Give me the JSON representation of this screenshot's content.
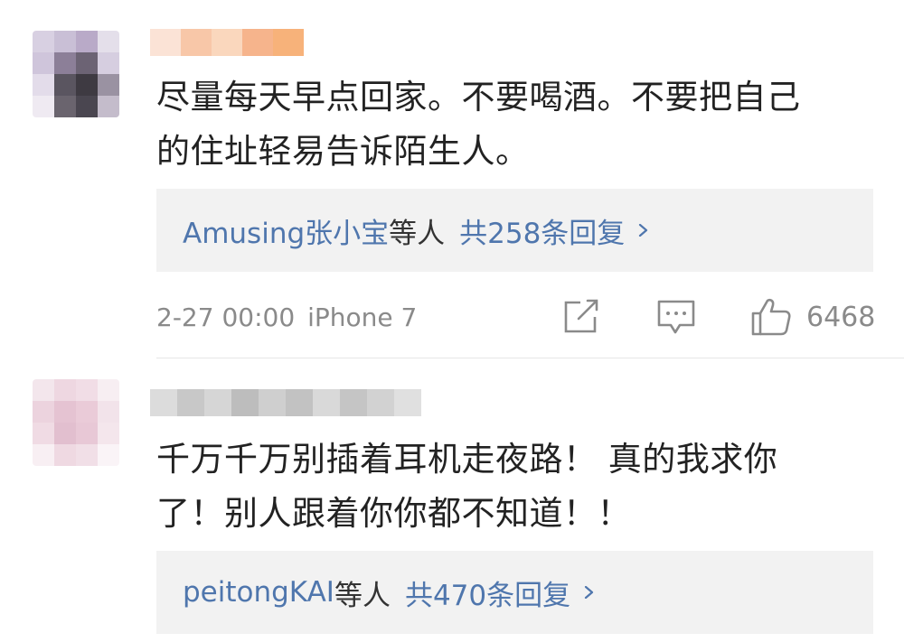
{
  "comments": [
    {
      "text_line1": "尽量每天早点回家。不要喝酒。不要把自己",
      "text_line2": "的住址轻易告诉陌生人。",
      "reply_users": "Amusing张小宝",
      "reply_others": "等人",
      "reply_count": "共258条回复",
      "timestamp": "2-27 00:00",
      "source": "iPhone 7",
      "likes": "6468"
    },
    {
      "text_line1": "千万千万别插着耳机走夜路！ 真的我求你",
      "text_line2": "了！别人跟着你你都不知道！！",
      "reply_users": "peitongKAI",
      "reply_others": "等人",
      "reply_count": "共470条回复"
    }
  ],
  "icons": {
    "share": "share-icon",
    "comment": "comment-icon",
    "like": "thumbs-up-icon",
    "chevron": "chevron-right-icon"
  },
  "colors": {
    "link": "#4f76ad",
    "meta": "#8a8a8a",
    "text": "#222222",
    "reply_bg": "#f2f2f2"
  }
}
